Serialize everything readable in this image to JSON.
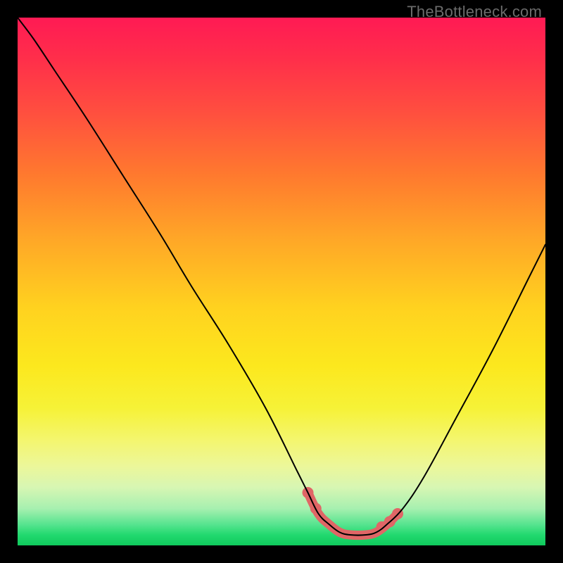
{
  "watermark": "TheBottleneck.com",
  "colors": {
    "background": "#000000",
    "curve": "#000000",
    "highlight": "#e06666",
    "gradient_top": "#ff1a54",
    "gradient_bottom": "#0fc95c"
  },
  "chart_data": {
    "type": "line",
    "title": "",
    "xlabel": "",
    "ylabel": "",
    "xlim": [
      0,
      100
    ],
    "ylim": [
      0,
      100
    ],
    "grid": false,
    "note": "Bottleneck-style V curve; y≈0 (green) is optimal, y→100 (red) is worst. Values estimated from pixel positions.",
    "series": [
      {
        "name": "main-curve",
        "x": [
          0,
          3,
          7,
          13,
          20,
          27,
          33,
          40,
          47,
          53,
          55,
          57,
          59,
          61,
          63,
          66,
          68,
          70,
          73,
          77,
          83,
          90,
          97,
          100
        ],
        "y": [
          100,
          96,
          90,
          81,
          70,
          59,
          49,
          38,
          26,
          14,
          10,
          6,
          4,
          2.5,
          2,
          2,
          2.5,
          4,
          7,
          13,
          24,
          37,
          51,
          57
        ]
      },
      {
        "name": "highlight-segment",
        "x": [
          55,
          57,
          59,
          61,
          63,
          66,
          68,
          70,
          72
        ],
        "y": [
          10,
          6,
          4,
          2.5,
          2,
          2,
          2.5,
          4,
          6
        ]
      }
    ],
    "highlight_markers": [
      {
        "x": 55,
        "y": 10
      },
      {
        "x": 56.5,
        "y": 7
      },
      {
        "x": 69,
        "y": 3.5
      },
      {
        "x": 70.5,
        "y": 4.5
      },
      {
        "x": 72,
        "y": 6
      }
    ]
  }
}
